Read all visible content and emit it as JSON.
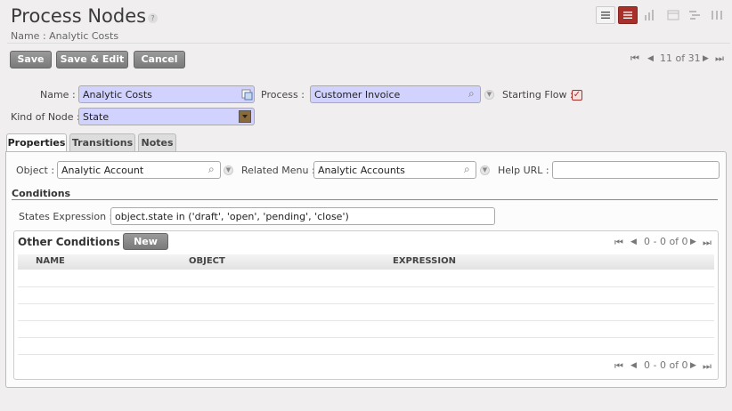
{
  "header": {
    "title": "Process Nodes",
    "help": "?",
    "subtitle": "Name : Analytic Costs"
  },
  "toolbar": {
    "save": "Save",
    "save_edit": "Save & Edit",
    "cancel": "Cancel"
  },
  "pager": {
    "first": "⏮",
    "prev": "◀",
    "text": "11 of 31",
    "next": "▶",
    "last": "⏭"
  },
  "form": {
    "name_label": "Name :",
    "name_value": "Analytic Costs",
    "process_label": "Process :",
    "process_value": "Customer Invoice",
    "starting_flow_label": "Starting Flow :",
    "starting_flow_checked": true,
    "kind_label": "Kind of Node :",
    "kind_value": "State"
  },
  "tabs": [
    "Properties",
    "Transitions",
    "Notes"
  ],
  "properties": {
    "object_label": "Object :",
    "object_value": "Analytic Account",
    "menu_label": "Related Menu :",
    "menu_value": "Analytic Accounts",
    "help_url_label": "Help URL :",
    "help_url_value": "",
    "conditions_title": "Conditions",
    "states_label": "States Expression :",
    "states_value": "object.state in ('draft', 'open', 'pending', 'close')"
  },
  "other_conditions": {
    "title": "Other Conditions",
    "new_button": "New",
    "pager_text": "0 - 0 of 0",
    "columns": [
      "NAME",
      "OBJECT",
      "EXPRESSION"
    ]
  },
  "colors": {
    "accent": "#a7302a",
    "required_field": "#d2d2ff"
  }
}
